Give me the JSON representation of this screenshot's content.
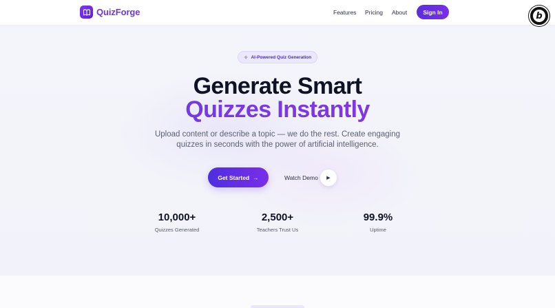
{
  "brand": {
    "name": "QuizForge",
    "logo_icon": "book-icon",
    "accent": "#6d36e6"
  },
  "nav": {
    "links": [
      "Features",
      "Pricing",
      "About"
    ],
    "signin_label": "Sign In"
  },
  "corner_badge": {
    "letter": "b"
  },
  "hero": {
    "pill_label": "AI-Powered Quiz Generation",
    "title_line1": "Generate Smart",
    "title_line2": "Quizzes Instantly",
    "subtitle_line1": "Upload content or describe a topic — we do the rest. Create engaging",
    "subtitle_line2": "quizzes in seconds with the power of artificial intelligence.",
    "primary_cta": "Get Started",
    "primary_cta_arrow": "→",
    "secondary_cta": "Watch Demo"
  },
  "stats": [
    {
      "value": "10,000+",
      "label": "Quizzes Generated"
    },
    {
      "value": "2,500+",
      "label": "Teachers Trust Us"
    },
    {
      "value": "99.9%",
      "label": "Uptime"
    }
  ]
}
